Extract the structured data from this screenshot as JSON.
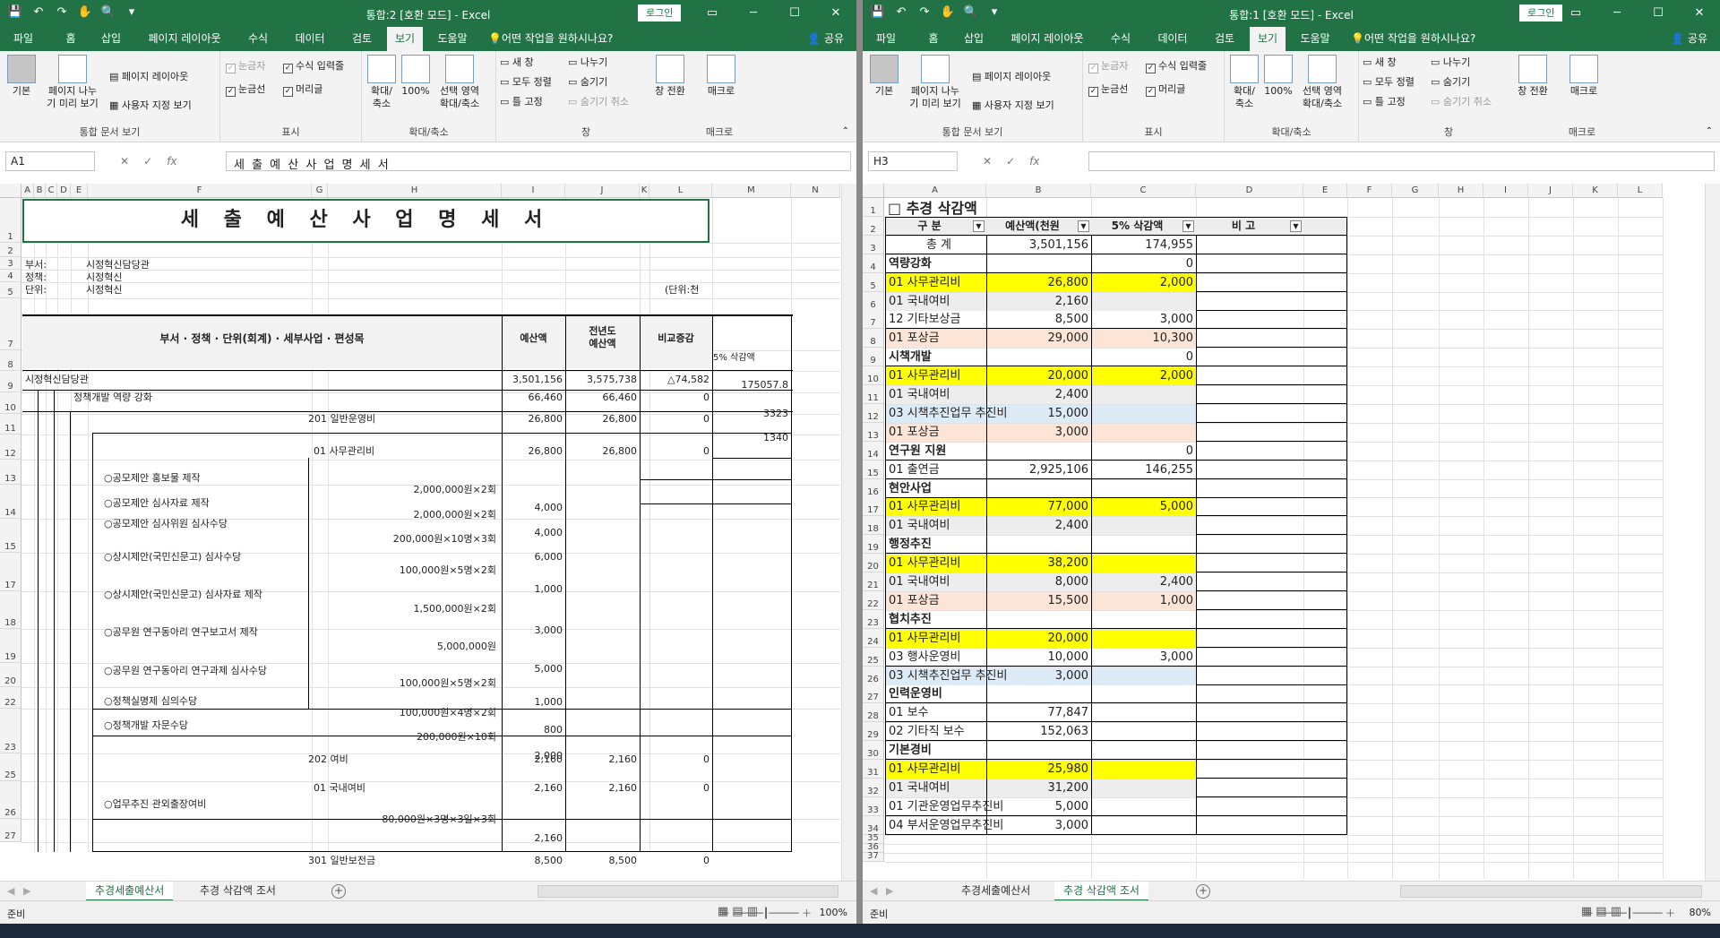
{
  "left": {
    "title": "통합:2  [호환 모드]  -  Excel",
    "login": "로그인",
    "tabs": [
      "파일",
      "홈",
      "삽입",
      "페이지 레이아웃",
      "수식",
      "데이터",
      "검토",
      "보기",
      "도움말"
    ],
    "tellme": "어떤 작업을 원하시나요?",
    "share": "공유",
    "namebox": "A1",
    "formula": "세 출 예 산 사 업 명 세 서",
    "status": "준비",
    "zoom": "100%",
    "sheet_tabs": [
      "추경세출예산서",
      "추경 삭감액 조서"
    ],
    "active_tab": 0
  },
  "right": {
    "title": "통합:1  [호환 모드]  -  Excel",
    "login": "로그인",
    "tabs": [
      "파일",
      "홈",
      "삽입",
      "페이지 레이아웃",
      "수식",
      "데이터",
      "검토",
      "보기",
      "도움말"
    ],
    "tellme": "어떤 작업을 원하시나요?",
    "share": "공유",
    "namebox": "H3",
    "formula": "",
    "status": "준비",
    "zoom": "80%",
    "sheet_tabs": [
      "추경세출예산서",
      "추경 삭감액 조서"
    ],
    "active_tab": 1
  },
  "ribbon": {
    "normal": "기본",
    "pagebreak": "페이지 나누\n기 미리 보기",
    "pagelayout": "페이지 레이아웃",
    "custom": "사용자 지정 보기",
    "views_group": "통합 문서 보기",
    "ruler": "눈금자",
    "formula_bar": "수식 입력줄",
    "gridlines": "눈금선",
    "headings": "머리글",
    "show_group": "표시",
    "zoom": "확대/\n축소",
    "zoom100": "100%",
    "zoomsel": "선택 영역\n확대/축소",
    "zoom_group": "확대/축소",
    "newwin": "새 창",
    "arrange": "모두 정렬",
    "freeze": "틀 고정",
    "split": "나누기",
    "hide": "숨기기",
    "unhide": "숨기기 취소",
    "switch": "창 전환",
    "window_group": "창",
    "macro": "매크로",
    "macro_group": "매크로"
  },
  "left_sheet": {
    "cols": [
      "A",
      "B",
      "C",
      "D",
      "E",
      "F",
      "G",
      "H",
      "I",
      "J",
      "K",
      "L",
      "M",
      "N"
    ],
    "rows": [
      "1",
      "2",
      "3",
      "4",
      "5",
      "7",
      "8",
      "9",
      "10",
      "11",
      "12",
      "13",
      "14",
      "15",
      "17",
      "18",
      "19",
      "20",
      "22",
      "23",
      "25",
      "26",
      "27"
    ],
    "title": "세 출 예 산 사 업 명 세 서",
    "dept_label": "부서:",
    "dept": "시정혁신담당관",
    "policy_label": "정책:",
    "policy": "시정혁신",
    "unit_label": "단위:",
    "unit": "시정혁신",
    "unit_note": "(단위:천",
    "hdr_main": "부서 · 정책 · 단위(회계) · 세부사업 · 편성목",
    "hdr_budget": "예산액",
    "hdr_prev": "전년도\n예산액",
    "hdr_diff": "비교증감",
    "hdr_cut": "5% 삭감액",
    "r8": [
      "시정혁신담당관",
      "3,501,156",
      "3,575,738",
      "△74,582",
      "175057.8"
    ],
    "r9": [
      "정책개발 역량 강화",
      "66,460",
      "66,460",
      "0",
      "3323"
    ],
    "r10": [
      "201 일반운영비",
      "26,800",
      "26,800",
      "0",
      "1340"
    ],
    "r11": [
      "01 사무관리비",
      "26,800",
      "26,800",
      "0"
    ],
    "items": [
      [
        "○공모제안 홍보물 제작",
        "2,000,000원×2회",
        "4,000"
      ],
      [
        "○공모제안 심사자료 제작",
        "2,000,000원×2회",
        "4,000"
      ],
      [
        "○공모제안 심사위원 심사수당",
        "200,000원×10명×3회",
        "6,000"
      ],
      [
        "○상시제안(국민신문고) 심사수당",
        "100,000원×5명×2회",
        "1,000"
      ],
      [
        "○상시제안(국민신문고) 심사자료 제작",
        "1,500,000원×2회",
        "3,000"
      ],
      [
        "○공무원 연구동아리 연구보고서 제작",
        "5,000,000원",
        "5,000"
      ],
      [
        "○공무원 연구동아리 연구과제 심사수당",
        "100,000원×5명×2회",
        "1,000"
      ],
      [
        "○정책실명제 심의수당",
        "100,000원×4명×2회",
        "800"
      ],
      [
        "○정책개발 자문수당",
        "200,000원×10회",
        "2,000"
      ]
    ],
    "r23": [
      "202 여비",
      "2,160",
      "2,160",
      "0"
    ],
    "r25": [
      "01 국내여비",
      "2,160",
      "2,160",
      "0"
    ],
    "r26": [
      "○업무추진 관외출장여비",
      "80,000원×3명×3일×3회",
      "2,160"
    ],
    "r27": [
      "301 일반보전금",
      "8,500",
      "8,500",
      "0"
    ]
  },
  "right_sheet": {
    "cols": [
      "A",
      "B",
      "C",
      "D",
      "E",
      "F",
      "G",
      "H",
      "I",
      "J",
      "K",
      "L"
    ],
    "title": "□ 추경 삭감액",
    "hdr": [
      "구  분",
      "예산액(천원",
      "5% 삭감액",
      "비    고"
    ],
    "rows": [
      {
        "n": "3",
        "a": "총  계",
        "b": "3,501,156",
        "c": "174,955",
        "t": "total"
      },
      {
        "n": "4",
        "a": "역량강화",
        "b": "",
        "c": "0",
        "t": "head"
      },
      {
        "n": "5",
        "a": "01 사무관리비",
        "b": "26,800",
        "c": "2,000",
        "t": "yellow"
      },
      {
        "n": "6",
        "a": "01 국내여비",
        "b": "2,160",
        "c": "",
        "t": "gray"
      },
      {
        "n": "7",
        "a": "12 기타보상금",
        "b": "8,500",
        "c": "3,000",
        "t": ""
      },
      {
        "n": "8",
        "a": "01 포상금",
        "b": "29,000",
        "c": "10,300",
        "t": "peach"
      },
      {
        "n": "9",
        "a": "시책개발",
        "b": "",
        "c": "0",
        "t": "head"
      },
      {
        "n": "10",
        "a": "01 사무관리비",
        "b": "20,000",
        "c": "2,000",
        "t": "yellow"
      },
      {
        "n": "11",
        "a": "01 국내여비",
        "b": "2,400",
        "c": "",
        "t": "gray"
      },
      {
        "n": "12",
        "a": "03 시책추진업무 추진비",
        "b": "15,000",
        "c": "",
        "t": "blue"
      },
      {
        "n": "13",
        "a": "01 포상금",
        "b": "3,000",
        "c": "",
        "t": "peach"
      },
      {
        "n": "14",
        "a": "연구원 지원",
        "b": "",
        "c": "0",
        "t": "head"
      },
      {
        "n": "15",
        "a": "01 출연금",
        "b": "2,925,106",
        "c": "146,255",
        "t": ""
      },
      {
        "n": "16",
        "a": "현안사업",
        "b": "",
        "c": "",
        "t": "head"
      },
      {
        "n": "17",
        "a": "01 사무관리비",
        "b": "77,000",
        "c": "5,000",
        "t": "yellow"
      },
      {
        "n": "18",
        "a": "01 국내여비",
        "b": "2,400",
        "c": "",
        "t": "gray"
      },
      {
        "n": "19",
        "a": "행정추진",
        "b": "",
        "c": "",
        "t": "head"
      },
      {
        "n": "20",
        "a": "01 사무관리비",
        "b": "38,200",
        "c": "",
        "t": "yellow"
      },
      {
        "n": "21",
        "a": "01 국내여비",
        "b": "8,000",
        "c": "2,400",
        "t": "gray"
      },
      {
        "n": "22",
        "a": "01 포상금",
        "b": "15,500",
        "c": "1,000",
        "t": "peach"
      },
      {
        "n": "23",
        "a": "협치추진",
        "b": "",
        "c": "",
        "t": "head"
      },
      {
        "n": "24",
        "a": "01 사무관리비",
        "b": "20,000",
        "c": "",
        "t": "yellow"
      },
      {
        "n": "25",
        "a": "03 행사운영비",
        "b": "10,000",
        "c": "3,000",
        "t": ""
      },
      {
        "n": "26",
        "a": "03 시책추진업무 추진비",
        "b": "3,000",
        "c": "",
        "t": "blue"
      },
      {
        "n": "27",
        "a": "인력운영비",
        "b": "",
        "c": "",
        "t": "head"
      },
      {
        "n": "28",
        "a": "01 보수",
        "b": "77,847",
        "c": "",
        "t": ""
      },
      {
        "n": "29",
        "a": "02 기타직 보수",
        "b": "152,063",
        "c": "",
        "t": ""
      },
      {
        "n": "30",
        "a": "기본경비",
        "b": "",
        "c": "",
        "t": "head"
      },
      {
        "n": "31",
        "a": "01 사무관리비",
        "b": "25,980",
        "c": "",
        "t": "yellow"
      },
      {
        "n": "32",
        "a": "01 국내여비",
        "b": "31,200",
        "c": "",
        "t": "gray"
      },
      {
        "n": "33",
        "a": "01 기관운영업무추진비",
        "b": "5,000",
        "c": "",
        "t": ""
      },
      {
        "n": "34",
        "a": "04 부서운영업무추진비",
        "b": "3,000",
        "c": "",
        "t": ""
      }
    ],
    "extra_rows": [
      "35",
      "36",
      "37"
    ]
  },
  "colors": {
    "excel_green": "#217346",
    "yellow": "#ffff00",
    "gray": "#ededed",
    "blue": "#ddebf7",
    "peach": "#fce4d6"
  }
}
